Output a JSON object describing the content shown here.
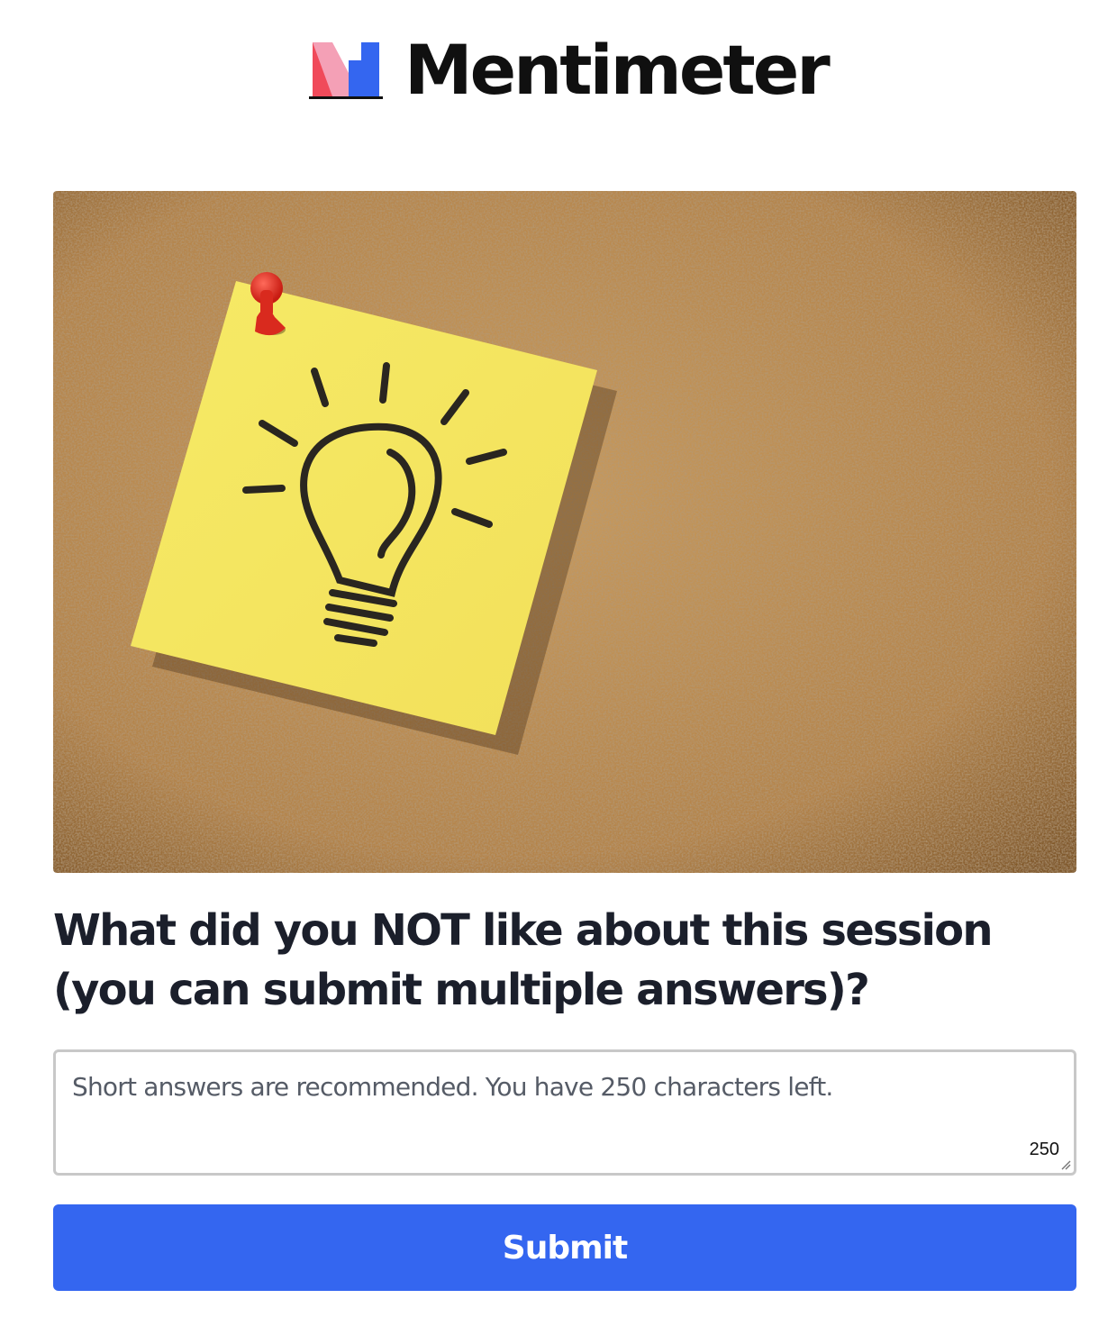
{
  "brand": {
    "name": "Mentimeter",
    "logo_icon": "mentimeter-logo-icon"
  },
  "hero_image": {
    "icon": "lightbulb-sticky-note-on-corkboard-image"
  },
  "question": {
    "text": "What did you NOT like about this session (you can submit multiple answers)?"
  },
  "answer": {
    "placeholder": "Short answers are recommended. You have 250 characters left.",
    "value": "",
    "chars_left": "250"
  },
  "submit": {
    "label": "Submit"
  },
  "colors": {
    "accent": "#3466f0",
    "text": "#1b1f2b"
  }
}
